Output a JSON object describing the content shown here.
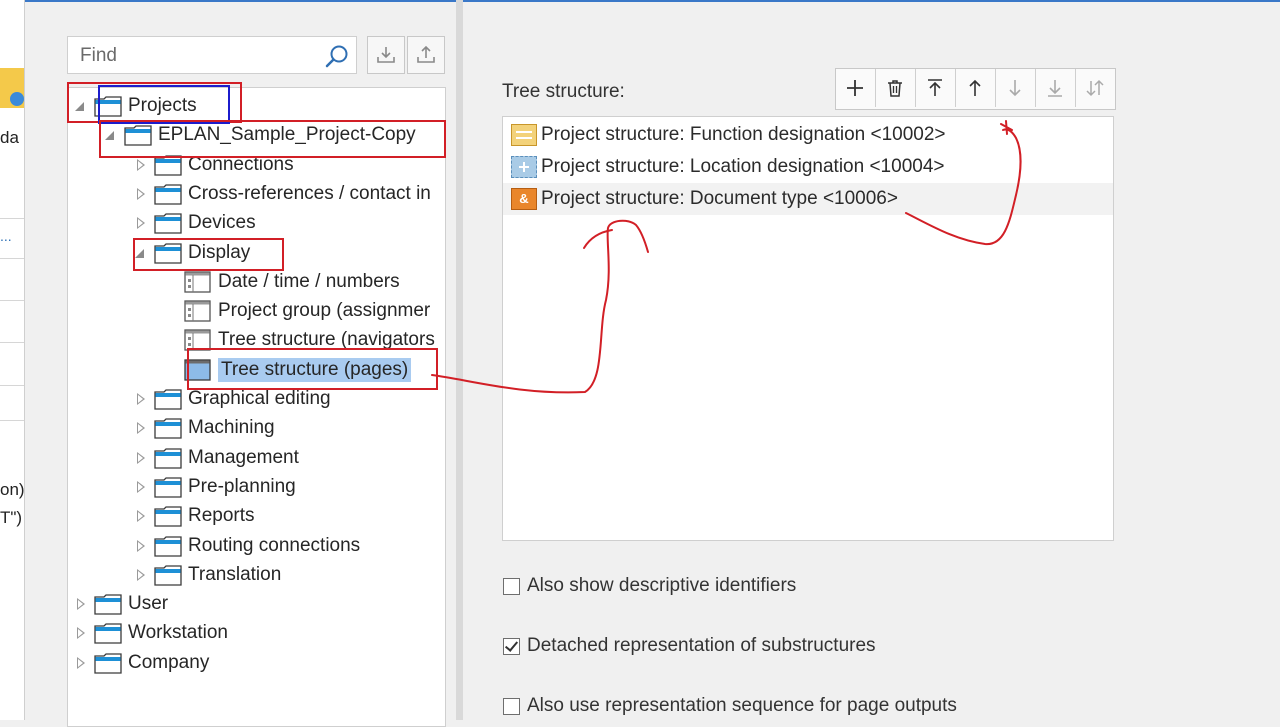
{
  "left_strip": {
    "fragments": [
      "da",
      "...",
      "on)",
      "T\")"
    ]
  },
  "find": {
    "placeholder": "Find"
  },
  "tree": {
    "nodes": [
      {
        "label": "Projects",
        "level": 0,
        "state": "open",
        "icon": "folder-icon"
      },
      {
        "label": "EPLAN_Sample_Project-Copy",
        "level": 1,
        "state": "open",
        "icon": "folder-icon"
      },
      {
        "label": "Connections",
        "level": 2,
        "state": "closed",
        "icon": "folder-icon"
      },
      {
        "label": "Cross-references / contact in",
        "level": 2,
        "state": "closed",
        "icon": "folder-icon"
      },
      {
        "label": "Devices",
        "level": 2,
        "state": "closed",
        "icon": "folder-icon"
      },
      {
        "label": "Display",
        "level": 2,
        "state": "open",
        "icon": "folder-icon"
      },
      {
        "label": "Date / time / numbers",
        "level": 3,
        "state": "leaf",
        "icon": "settings-page-icon"
      },
      {
        "label": "Project group (assignmer",
        "level": 3,
        "state": "leaf",
        "icon": "settings-page-icon"
      },
      {
        "label": "Tree structure (navigators",
        "level": 3,
        "state": "leaf",
        "icon": "settings-page-icon"
      },
      {
        "label": "Tree structure (pages)",
        "level": 3,
        "state": "leaf",
        "icon": "settings-page-icon",
        "selected": true
      },
      {
        "label": "Graphical editing",
        "level": 2,
        "state": "closed",
        "icon": "folder-icon"
      },
      {
        "label": "Machining",
        "level": 2,
        "state": "closed",
        "icon": "folder-icon"
      },
      {
        "label": "Management",
        "level": 2,
        "state": "closed",
        "icon": "folder-icon"
      },
      {
        "label": "Pre-planning",
        "level": 2,
        "state": "closed",
        "icon": "folder-icon"
      },
      {
        "label": "Reports",
        "level": 2,
        "state": "closed",
        "icon": "folder-icon"
      },
      {
        "label": "Routing connections",
        "level": 2,
        "state": "closed",
        "icon": "folder-icon"
      },
      {
        "label": "Translation",
        "level": 2,
        "state": "closed",
        "icon": "folder-icon"
      },
      {
        "label": "User",
        "level": 0,
        "state": "closed",
        "icon": "folder-icon"
      },
      {
        "label": "Workstation",
        "level": 0,
        "state": "closed",
        "icon": "folder-icon"
      },
      {
        "label": "Company",
        "level": 0,
        "state": "closed",
        "icon": "folder-icon"
      }
    ]
  },
  "right": {
    "tree_structure_label": "Tree structure:",
    "toolbar": [
      {
        "name": "new-button",
        "icon": "plus-icon"
      },
      {
        "name": "delete-button",
        "icon": "trash-icon"
      },
      {
        "name": "move-to-top-button",
        "icon": "arrow-to-top-icon"
      },
      {
        "name": "move-up-button",
        "icon": "arrow-up-icon"
      },
      {
        "name": "move-down-button",
        "icon": "arrow-down-icon"
      },
      {
        "name": "move-to-bottom-button",
        "icon": "arrow-to-bottom-icon"
      },
      {
        "name": "sort-button",
        "icon": "sort-icon"
      }
    ],
    "structure_items": [
      {
        "text": "Project structure: Function designation <10002>",
        "icon": "function-designation-icon",
        "color": "#e7b33a"
      },
      {
        "text": "Project structure: Location designation <10004>",
        "icon": "location-designation-icon",
        "color": "#7fb1d8"
      },
      {
        "text": "Project structure: Document type <10006>",
        "icon": "document-type-icon",
        "color": "#e9862b",
        "symbol": "&"
      }
    ],
    "checkboxes": [
      {
        "label": "Also show descriptive identifiers",
        "checked": false
      },
      {
        "label": "Detached representation of substructures",
        "checked": true
      },
      {
        "label": "Also use representation sequence for page outputs",
        "checked": false
      }
    ]
  },
  "colors": {
    "annotation_red": "#d21f26",
    "annotation_blue": "#1c1ccc",
    "selection": "#a9cbf0",
    "folder_blue": "#1e90d6"
  }
}
